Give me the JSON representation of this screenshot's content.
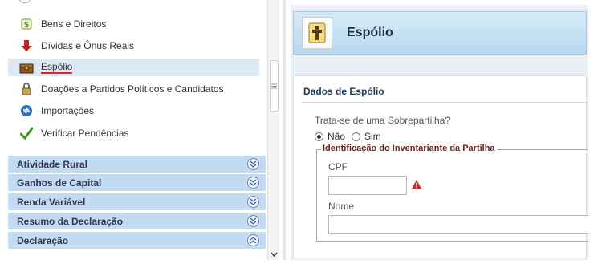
{
  "sidebar": {
    "items": [
      {
        "label": "Bens e Direitos",
        "icon": "money-bag-icon"
      },
      {
        "label": "Dívidas e Ônus Reais",
        "icon": "red-down-arrow-icon"
      },
      {
        "label": "Espólio",
        "icon": "treasure-chest-icon",
        "selected": true
      },
      {
        "label": "Doações a Partidos Políticos e Candidatos",
        "icon": "padlock-icon"
      },
      {
        "label": "Importações",
        "icon": "sync-icon"
      },
      {
        "label": "Verificar Pendências",
        "icon": "green-check-icon"
      }
    ],
    "sections": [
      {
        "label": "Atividade Rural",
        "state": "collapsed"
      },
      {
        "label": "Ganhos de Capital",
        "state": "collapsed"
      },
      {
        "label": "Renda Variável",
        "state": "collapsed"
      },
      {
        "label": "Resumo da Declaração",
        "state": "collapsed"
      },
      {
        "label": "Declaração",
        "state": "expanded"
      }
    ]
  },
  "header": {
    "title": "Espólio",
    "icon": "cross-icon"
  },
  "form": {
    "section_title": "Dados de Espólio",
    "question": "Trata-se de uma Sobrepartilha?",
    "options": [
      {
        "label": "Não",
        "selected": true
      },
      {
        "label": "Sim",
        "selected": false
      }
    ],
    "group_legend": "Identificação do Inventariante da Partilha",
    "cpf_label": "CPF",
    "cpf_value": "",
    "nome_label": "Nome",
    "nome_value": ""
  },
  "colors": {
    "section_bg": "#c3daf3",
    "selected_bg": "#dbe9f7",
    "header_gradient_top": "#d6eaf8",
    "header_gradient_bottom": "#b7d8f1",
    "warning": "#d62828",
    "legend_text": "#6b2222"
  }
}
